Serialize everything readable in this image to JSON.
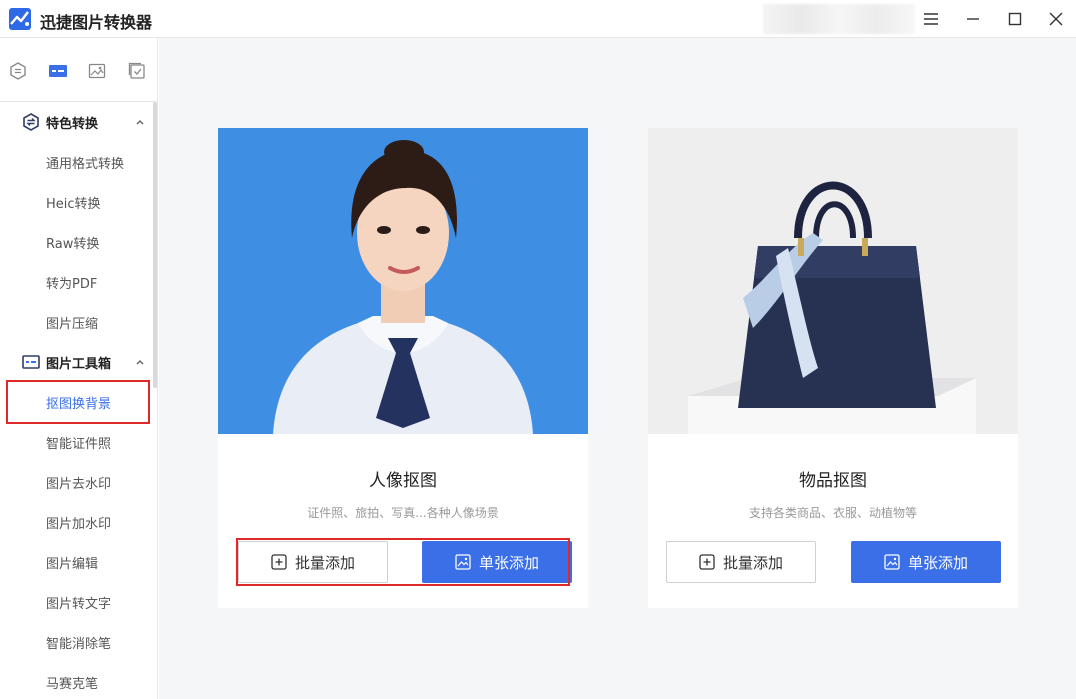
{
  "app": {
    "title": "迅捷图片转换器"
  },
  "sidebar": {
    "sections": [
      {
        "label": "特色转换",
        "items": [
          "通用格式转换",
          "Heic转换",
          "Raw转换",
          "转为PDF",
          "图片压缩"
        ]
      },
      {
        "label": "图片工具箱",
        "items": [
          "抠图换背景",
          "智能证件照",
          "图片去水印",
          "图片加水印",
          "图片编辑",
          "图片转文字",
          "智能消除笔",
          "马赛克笔"
        ]
      }
    ],
    "active_item": "抠图换背景"
  },
  "cards": [
    {
      "title": "人像抠图",
      "subtitle": "证件照、旅拍、写真...各种人像场景",
      "batch_label": "批量添加",
      "single_label": "单张添加"
    },
    {
      "title": "物品抠图",
      "subtitle": "支持各类商品、衣服、动植物等",
      "batch_label": "批量添加",
      "single_label": "单张添加"
    }
  ],
  "colors": {
    "accent": "#3a6fe8",
    "highlight": "#e02828",
    "portrait_bg": "#3e8ee4"
  }
}
